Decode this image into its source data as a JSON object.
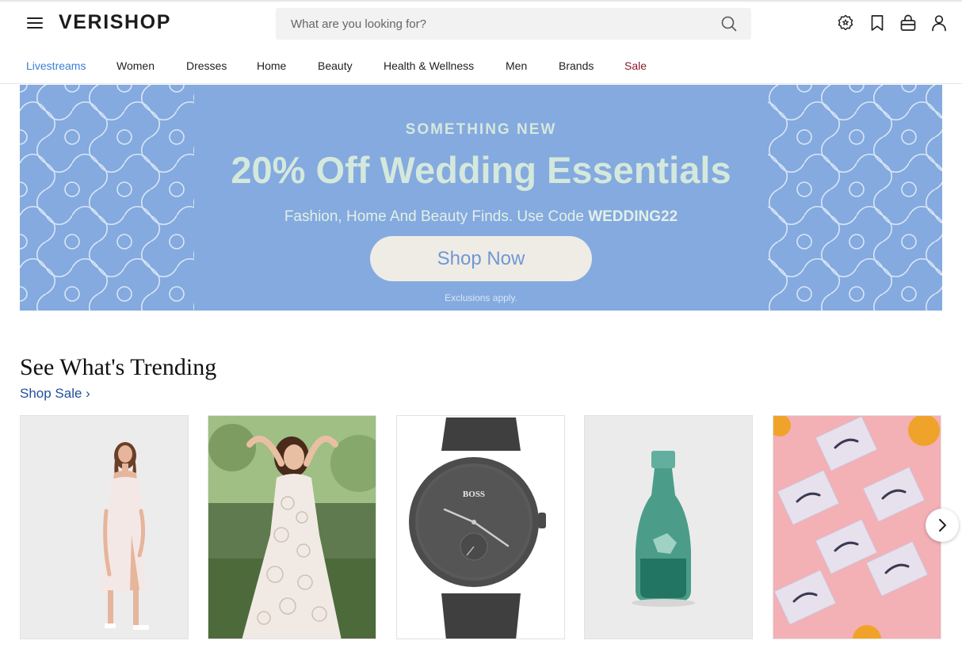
{
  "header": {
    "logo": "VERISHOP",
    "search_placeholder": "What are you looking for?",
    "icons": [
      "menu-icon",
      "search-icon",
      "rewards-badge-icon",
      "bookmark-icon",
      "bag-icon",
      "user-icon"
    ]
  },
  "nav": {
    "items": [
      {
        "label": "Livestreams",
        "color": "#3a7fd4"
      },
      {
        "label": "Women"
      },
      {
        "label": "Dresses"
      },
      {
        "label": "Home"
      },
      {
        "label": "Beauty"
      },
      {
        "label": "Health & Wellness"
      },
      {
        "label": "Men"
      },
      {
        "label": "Brands"
      },
      {
        "label": "Sale",
        "color": "#8a1a2a"
      }
    ]
  },
  "banner": {
    "eyebrow": "SOMETHING NEW",
    "title": "20% Off Wedding Essentials",
    "subtitle_prefix": "Fashion, Home And Beauty Finds. Use Code ",
    "code": "WEDDING22",
    "cta": "Shop Now",
    "note": "Exclusions apply.",
    "background": "#84aadf",
    "text_color": "#d4e8dc"
  },
  "trending": {
    "title": "See What's Trending",
    "link": "Shop Sale ›",
    "products": [
      {
        "name": "white-slip-dress-product"
      },
      {
        "name": "lace-dress-product"
      },
      {
        "name": "black-boss-watch-product",
        "brand": "BOSS"
      },
      {
        "name": "green-glass-carafe-product"
      },
      {
        "name": "false-eyelashes-product"
      }
    ],
    "next_icon": "chevron-right-icon"
  }
}
